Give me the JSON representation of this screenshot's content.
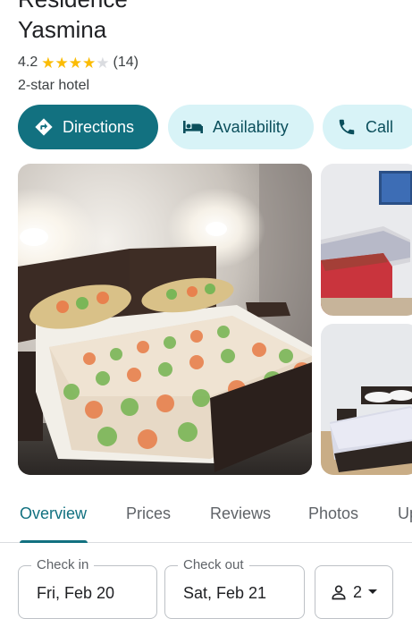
{
  "place": {
    "name_line1": "Residence",
    "name_line2": "Yasmina",
    "rating": "4.2",
    "stars_filled": 4,
    "stars_total": 5,
    "review_count": "(14)",
    "category": "2-star hotel"
  },
  "actions": {
    "directions": "Directions",
    "availability": "Availability",
    "call": "Call"
  },
  "photos": {
    "main": "hotel-room-photo",
    "side_top": "hotel-room-photo",
    "side_bottom": "hotel-room-photo"
  },
  "tabs": [
    "Overview",
    "Prices",
    "Reviews",
    "Photos",
    "Up"
  ],
  "booking": {
    "checkin_label": "Check in",
    "checkin_value": "Fri, Feb 20",
    "checkout_label": "Check out",
    "checkout_value": "Sat, Feb 21",
    "guests": "2"
  },
  "colors": {
    "primary": "#127180",
    "secondary_chip": "#d8f3f7",
    "star": "#fbbc04"
  }
}
